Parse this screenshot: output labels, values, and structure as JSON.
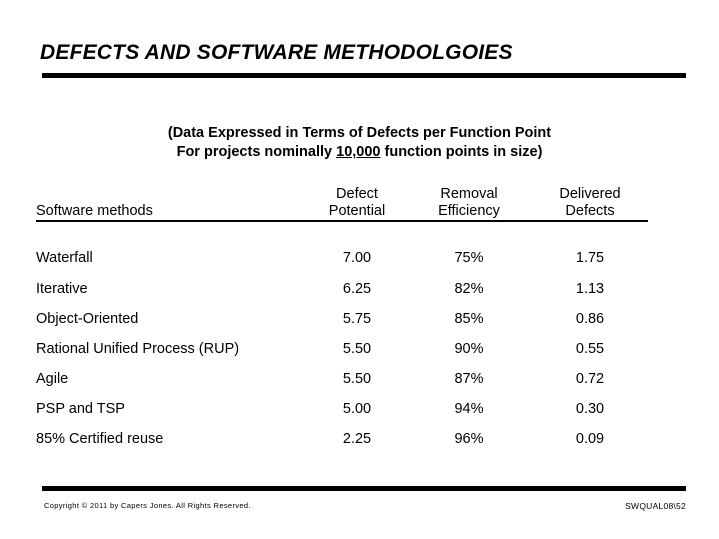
{
  "slide": {
    "title": "DEFECTS AND SOFTWARE METHODOLGOIES",
    "subtitle_line1": "(Data Expressed in Terms of Defects per Function Point",
    "subtitle_line2_before": "For projects nominally ",
    "subtitle_line2_underlined": "10,000",
    "subtitle_line2_after": " function points in size)",
    "rule_color": "#000000",
    "text_color": "#000000",
    "background_color": "#ffffff"
  },
  "table": {
    "headers": [
      {
        "line1": "",
        "line2": "Software methods"
      },
      {
        "line1": "Defect",
        "line2": "Potential"
      },
      {
        "line1": "Removal",
        "line2": "Efficiency"
      },
      {
        "line1": "Delivered",
        "line2": "Defects"
      }
    ],
    "rows": [
      {
        "method": "Waterfall",
        "defect_potential": "7.00",
        "removal_efficiency": "75%",
        "delivered_defects": "1.75"
      },
      {
        "method": "Iterative",
        "defect_potential": "6.25",
        "removal_efficiency": "82%",
        "delivered_defects": "1.13"
      },
      {
        "method": "Object-Oriented",
        "defect_potential": "5.75",
        "removal_efficiency": "85%",
        "delivered_defects": "0.86"
      },
      {
        "method": "Rational Unified Process (RUP)",
        "defect_potential": "5.50",
        "removal_efficiency": "90%",
        "delivered_defects": "0.55"
      },
      {
        "method": "Agile",
        "defect_potential": "5.50",
        "removal_efficiency": "87%",
        "delivered_defects": "0.72"
      },
      {
        "method": "PSP and TSP",
        "defect_potential": "5.00",
        "removal_efficiency": "94%",
        "delivered_defects": "0.30"
      },
      {
        "method": "85% Certified reuse",
        "defect_potential": "2.25",
        "removal_efficiency": "96%",
        "delivered_defects": "0.09"
      }
    ]
  },
  "footer": {
    "copyright": "Copyright © 2011 by Capers Jones.  All Rights Reserved.",
    "reference": "SWQUAL08\\52"
  },
  "chart_data": {
    "type": "table",
    "title": "DEFECTS AND SOFTWARE METHODOLGOIES",
    "subtitle": "(Data Expressed in Terms of Defects per Function Point For projects nominally 10,000 function points in size)",
    "columns": [
      "Software methods",
      "Defect Potential",
      "Removal Efficiency",
      "Delivered Defects"
    ],
    "categories": [
      "Waterfall",
      "Iterative",
      "Object-Oriented",
      "Rational Unified Process (RUP)",
      "Agile",
      "PSP and TSP",
      "85% Certified reuse"
    ],
    "series": [
      {
        "name": "Defect Potential",
        "values": [
          7.0,
          6.25,
          5.75,
          5.5,
          5.5,
          5.0,
          2.25
        ],
        "unit": "defects per function point"
      },
      {
        "name": "Removal Efficiency",
        "values": [
          75,
          82,
          85,
          90,
          87,
          94,
          96
        ],
        "unit": "%"
      },
      {
        "name": "Delivered Defects",
        "values": [
          1.75,
          1.13,
          0.86,
          0.55,
          0.72,
          0.3,
          0.09
        ],
        "unit": "defects per function point"
      }
    ]
  }
}
